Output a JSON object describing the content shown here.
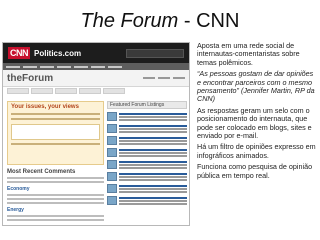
{
  "slide": {
    "title_italic": "The Forum",
    "title_rest": " - CNN"
  },
  "screenshot": {
    "cnn_logo": "CNN",
    "cnn_subtitle": "Politics.com",
    "forum_logo": "theForum",
    "issues_title": "Your issues, your views",
    "recent_title": "Most Recent Comments",
    "section_economy": "Economy",
    "section_energy": "Energy",
    "side_title": "Featured Forum Listings"
  },
  "description": {
    "p1": "Aposta em uma rede social de internautas-comentaristas sobre temas polêmicos.",
    "p2": "“As pessoas gostam de dar opiniões e encontrar parceiros com o mesmo pensamento” (Jennifer Martin, RP da CNN)",
    "p3": "As respostas geram um selo com o posicionamento do internauta, que pode ser colocado em blogs, sites e enviado por e-mail.",
    "p4": "Há um filtro de opiniões expresso em infográficos animados.",
    "p5": "Funciona como pesquisa de opinião pública em tempo real."
  }
}
